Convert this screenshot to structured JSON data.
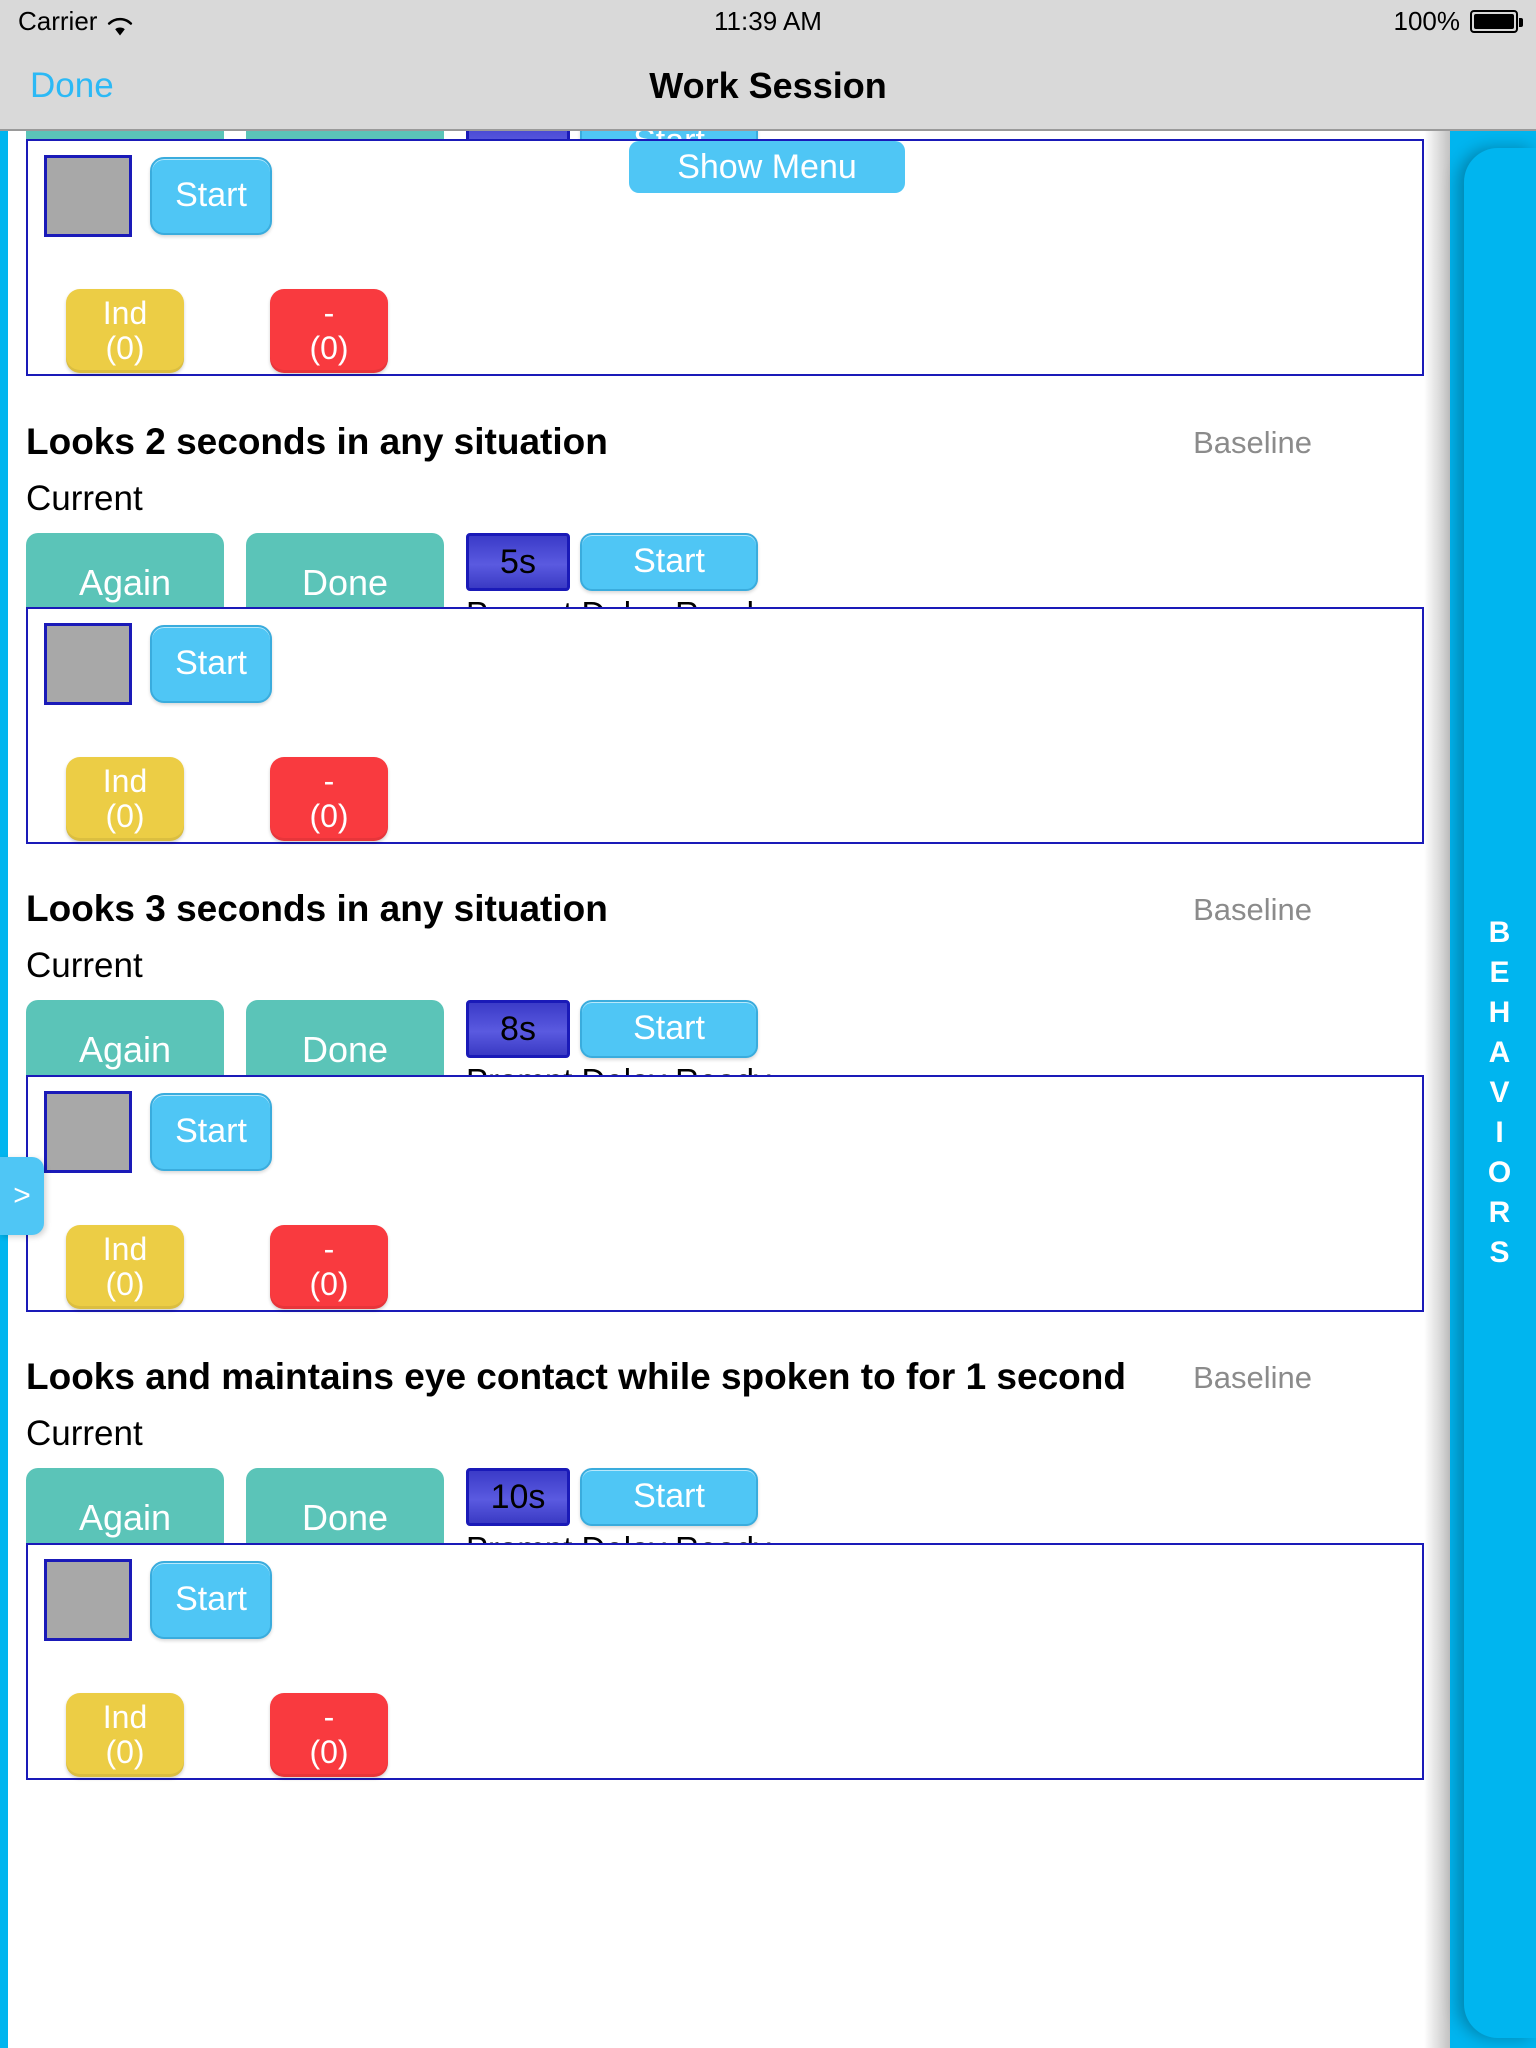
{
  "status_bar": {
    "carrier": "Carrier",
    "wifi_icon": "wifi-icon",
    "time": "11:39 AM",
    "battery_percent": "100%",
    "battery_icon": "battery-full-icon"
  },
  "nav_bar": {
    "done_label": "Done",
    "title": "Work Session"
  },
  "floating": {
    "show_menu_label": "Show Menu",
    "left_tab_label": ">"
  },
  "right_drawer": {
    "label": "BEHAVIORS",
    "letters": [
      "B",
      "E",
      "H",
      "A",
      "V",
      "I",
      "O",
      "R",
      "S"
    ]
  },
  "common": {
    "again_label": "Again",
    "done_label": "Done",
    "start_label": "Start",
    "current_label": "Current",
    "prompt_delay_ready_label": "Prompt Delay Ready",
    "phase_baseline": "Baseline",
    "ind_label": "Ind",
    "ind_count": "(0)",
    "minus_label": "-",
    "minus_count": "(0)"
  },
  "colors": {
    "accent_blue": "#00b5ef",
    "button_blue": "#4fc6f5",
    "teal": "#5bc4b8",
    "yellow": "#eccd45",
    "red": "#f93a3f",
    "card_border": "#1a1ab8",
    "delay_chip": "#3b3bc8",
    "gray_box": "#a8a8a8",
    "nav_bg": "#d9d9d9",
    "phase_text": "#8b8b8b"
  },
  "programs": [
    {
      "id": "cut-off-top",
      "title": "",
      "phase": "",
      "current_label": "Current",
      "delay": "",
      "prompt_status": "Prompt Delay Ready",
      "partial": true
    },
    {
      "id": "looks-2-seconds",
      "title": "Looks 2 seconds in any situation",
      "phase": "Baseline",
      "current_label": "Current",
      "delay": "5s",
      "prompt_status": "Prompt Delay Ready",
      "partial": false
    },
    {
      "id": "looks-3-seconds",
      "title": "Looks 3 seconds in any situation",
      "phase": "Baseline",
      "current_label": "Current",
      "delay": "8s",
      "prompt_status": "Prompt Delay Ready",
      "partial": false
    },
    {
      "id": "looks-eye-contact-1-second",
      "title": "Looks and maintains eye contact while spoken to for 1 second",
      "phase": "Baseline",
      "current_label": "Current",
      "delay": "10s",
      "prompt_status": "Prompt Delay Ready",
      "partial": false
    }
  ],
  "trial_cards": [
    {
      "id": "trial-card-1",
      "start_label": "Start",
      "ind_label": "Ind",
      "ind_count": "(0)",
      "minus_label": "-",
      "minus_count": "(0)"
    },
    {
      "id": "trial-card-2",
      "start_label": "Start",
      "ind_label": "Ind",
      "ind_count": "(0)",
      "minus_label": "-",
      "minus_count": "(0)"
    },
    {
      "id": "trial-card-3",
      "start_label": "Start",
      "ind_label": "Ind",
      "ind_count": "(0)",
      "minus_label": "-",
      "minus_count": "(0)"
    },
    {
      "id": "trial-card-4",
      "start_label": "Start",
      "ind_label": "Ind",
      "ind_count": "(0)",
      "minus_label": "-",
      "minus_count": "(0)"
    }
  ]
}
